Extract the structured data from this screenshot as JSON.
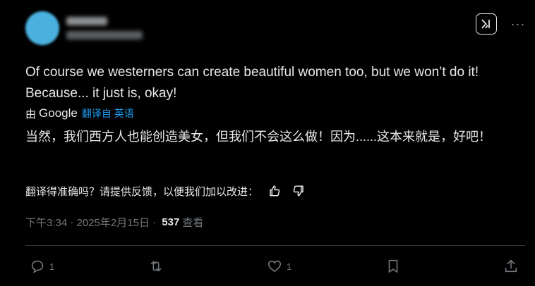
{
  "tweet": {
    "body": "Of course we westerners can create beautiful women too, but we won’t do it! Because... it just is, okay!",
    "translation": {
      "by_label": "由",
      "provider": "Google",
      "link_label": "翻译自 英语",
      "text": "当然，我们西方人也能创造美女，但我们不会这么做！因为......这本来就是，好吧！"
    },
    "rating_prompt": "翻译得准确吗？请提供反馈，以便我们加以改进：",
    "meta": {
      "time": "下午3:34",
      "separator": " · ",
      "date": "2025年2月15日",
      "view_count": "537",
      "views_label": "查看"
    },
    "actions": {
      "reply_count": "1",
      "like_count": "1"
    },
    "more_label": "···"
  }
}
